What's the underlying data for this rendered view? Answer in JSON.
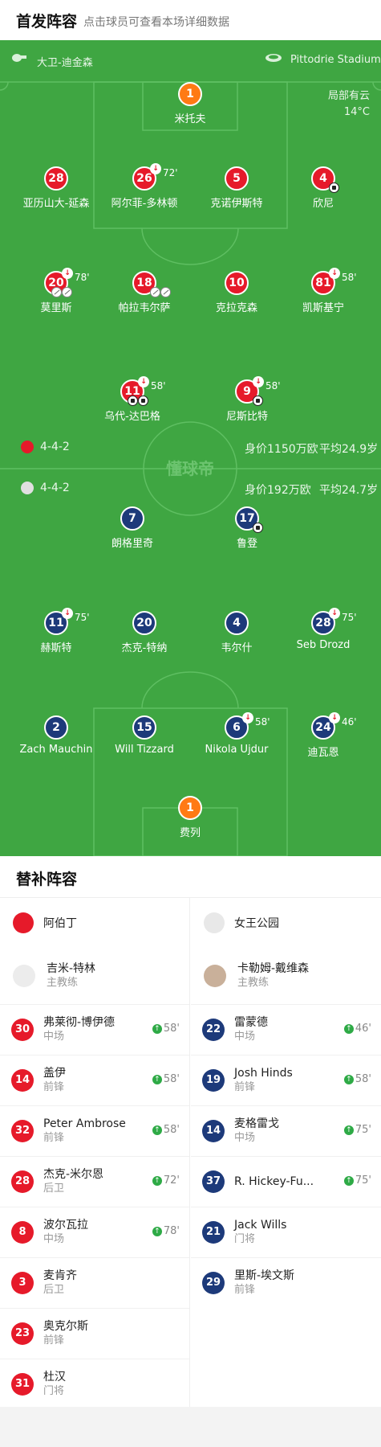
{
  "header": {
    "title": "首发阵容",
    "hint": "点击球员可查看本场详细数据"
  },
  "match": {
    "referee": "大卫-迪金森",
    "stadium": "Pittodrie Stadium",
    "weather": "局部有云",
    "temperature": "14°C"
  },
  "home": {
    "formation": "4-4-2",
    "value": "身价1150万欧",
    "avg_age": "平均24.9岁"
  },
  "away": {
    "formation": "4-4-2",
    "value": "身价192万欧",
    "avg_age": "平均24.7岁"
  },
  "watermark": "懂球帝",
  "p": {
    "h1": {
      "num": "1",
      "name": "米托夫"
    },
    "h28": {
      "num": "28",
      "name": "亚历山大-延森"
    },
    "h26": {
      "num": "26",
      "name": "阿尔菲-多林顿",
      "sub": "72'"
    },
    "h5": {
      "num": "5",
      "name": "克诺伊斯特"
    },
    "h4": {
      "num": "4",
      "name": "欣尼"
    },
    "h20": {
      "num": "20",
      "name": "莫里斯",
      "sub": "78'"
    },
    "h18": {
      "num": "18",
      "name": "帕拉韦尔萨"
    },
    "h10": {
      "num": "10",
      "name": "克拉克森"
    },
    "h81": {
      "num": "81",
      "name": "凯斯基宁",
      "sub": "58'"
    },
    "h11": {
      "num": "11",
      "name": "乌代-达巴格",
      "sub": "58'"
    },
    "h9": {
      "num": "9",
      "name": "尼斯比特",
      "sub": "58'"
    },
    "a7": {
      "num": "7",
      "name": "朗格里奇"
    },
    "a17": {
      "num": "17",
      "name": "鲁登"
    },
    "a11": {
      "num": "11",
      "name": "赫斯特",
      "sub": "75'"
    },
    "a20": {
      "num": "20",
      "name": "杰克-特纳"
    },
    "a4": {
      "num": "4",
      "name": "韦尔什"
    },
    "a28": {
      "num": "28",
      "name": "Seb Drozd",
      "sub": "75'"
    },
    "a2": {
      "num": "2",
      "name": "Zach Mauchin"
    },
    "a15": {
      "num": "15",
      "name": "Will Tizzard"
    },
    "a6": {
      "num": "6",
      "name": "Nikola Ujdur",
      "sub": "58'"
    },
    "a24": {
      "num": "24",
      "name": "迪瓦恩",
      "sub": "46'"
    },
    "a1": {
      "num": "1",
      "name": "费列"
    }
  },
  "subs_title": "替补阵容",
  "home_team": {
    "name": "阿伯丁",
    "coach": "吉米-特林",
    "coach_role": "主教练"
  },
  "away_team": {
    "name": "女王公园",
    "coach": "卡勒姆-戴维森",
    "coach_role": "主教练"
  },
  "home_subs": [
    {
      "num": "30",
      "name": "弗莱彻-博伊德",
      "pos": "中场",
      "in": "58'"
    },
    {
      "num": "14",
      "name": "盖伊",
      "pos": "前锋",
      "in": "58'"
    },
    {
      "num": "32",
      "name": "Peter Ambrose",
      "pos": "前锋",
      "in": "58'"
    },
    {
      "num": "28",
      "name": "杰克-米尔恩",
      "pos": "后卫",
      "in": "72'"
    },
    {
      "num": "8",
      "name": "波尔瓦拉",
      "pos": "中场",
      "in": "78'"
    },
    {
      "num": "3",
      "name": "麦肯齐",
      "pos": "后卫"
    },
    {
      "num": "23",
      "name": "奥克尔斯",
      "pos": "前锋"
    },
    {
      "num": "31",
      "name": "杜汉",
      "pos": "门将"
    }
  ],
  "away_subs": [
    {
      "num": "22",
      "name": "雷蒙德",
      "pos": "中场",
      "in": "46'"
    },
    {
      "num": "19",
      "name": "Josh Hinds",
      "pos": "前锋",
      "in": "58'"
    },
    {
      "num": "14",
      "name": "麦格雷戈",
      "pos": "中场",
      "in": "75'"
    },
    {
      "num": "37",
      "name": "R. Hickey-Fu...",
      "pos": "",
      "in": "75'"
    },
    {
      "num": "21",
      "name": "Jack Wills",
      "pos": "门将"
    },
    {
      "num": "29",
      "name": "里斯-埃文斯",
      "pos": "前锋"
    }
  ]
}
